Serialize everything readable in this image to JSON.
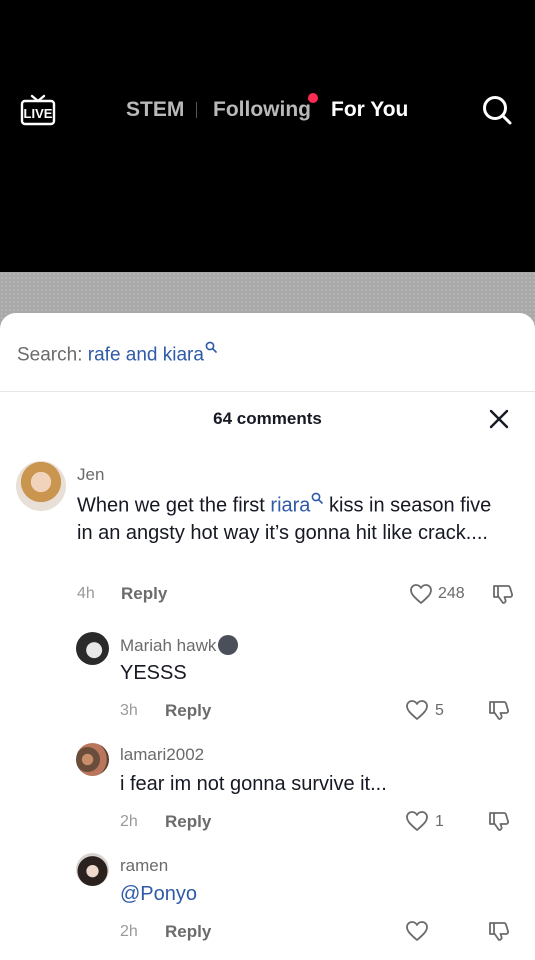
{
  "nav": {
    "live_label": "LIVE",
    "tabs": [
      "STEM",
      "Following",
      "For You"
    ],
    "active_tab": "For You"
  },
  "sheet": {
    "search_prefix": "Search:",
    "search_term": "rafe and kiara",
    "comment_count": "64 comments"
  },
  "comments": [
    {
      "username": "Jen",
      "text_before": "When we get the first ",
      "link": "riara",
      "text_after": " kiss in season five in an angsty hot way it’s gonna hit like crack....",
      "time": "4h",
      "reply": "Reply",
      "likes": "248"
    },
    {
      "username": "Mariah hawk",
      "text": "YESSS",
      "time": "3h",
      "reply": "Reply",
      "likes": "5"
    },
    {
      "username": "lamari2002",
      "text": "i fear im not gonna survive it...",
      "time": "2h",
      "reply": "Reply",
      "likes": "1"
    },
    {
      "username": "ramen",
      "mention": "@Ponyo",
      "time": "2h",
      "reply": "Reply",
      "likes": ""
    }
  ],
  "colors": {
    "accent_blue": "#2f5aa8",
    "notification_dot": "#fe2c55"
  }
}
